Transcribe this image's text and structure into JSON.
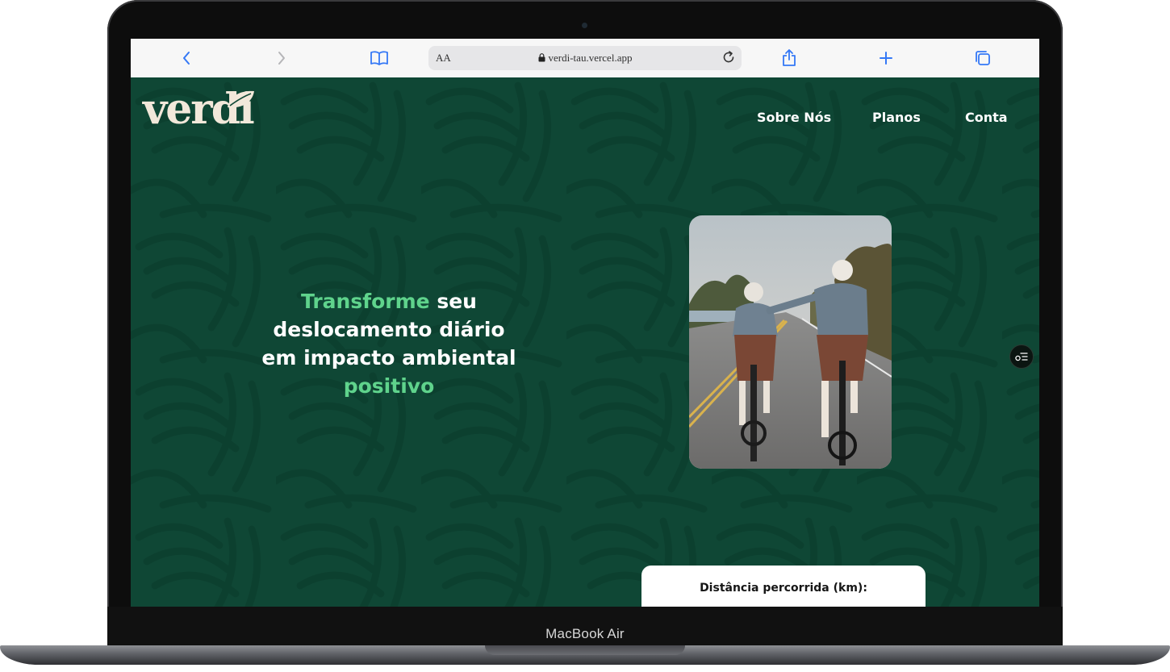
{
  "device": {
    "model_label": "MacBook Air"
  },
  "browser": {
    "reader_label": "AA",
    "url": "verdi-tau.vercel.app",
    "icons": [
      "chevron-left-icon",
      "chevron-right-icon",
      "book-icon",
      "lock-icon",
      "reload-icon",
      "share-icon",
      "plus-icon",
      "tabs-icon"
    ]
  },
  "site": {
    "logo_text": "verdi",
    "nav": [
      {
        "label": "Sobre Nós"
      },
      {
        "label": "Planos"
      },
      {
        "label": "Conta"
      }
    ],
    "hero": {
      "line1_accent": "Transforme",
      "line1_rest": " seu",
      "line2": "deslocamento diário",
      "line3": "em impacto ambiental",
      "line4_accent": "positivo"
    },
    "calculator": {
      "distance_label": "Distância percorrida (km):"
    },
    "floating_button_icon": "settings-list-icon"
  },
  "colors": {
    "page_bg": "#0f4735",
    "accent": "#5fd38c",
    "logo": "#f2e8da",
    "browser_blue": "#3478f6"
  }
}
